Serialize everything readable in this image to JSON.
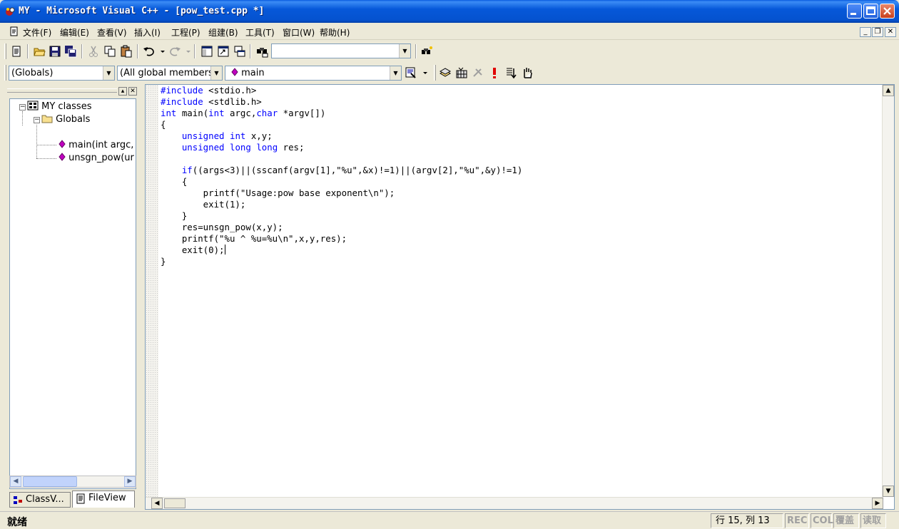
{
  "window": {
    "title": "MY - Microsoft Visual C++ - [pow_test.cpp *]"
  },
  "menu": {
    "items": [
      "文件(F)",
      "编辑(E)",
      "查看(V)",
      "插入(I)",
      "工程(P)",
      "组建(B)",
      "工具(T)",
      "窗口(W)",
      "帮助(H)"
    ]
  },
  "toolbar": {
    "find_value": ""
  },
  "wizardbar": {
    "scope": "(Globals)",
    "filter": "(All global members",
    "member": "main"
  },
  "workspace": {
    "tree": {
      "root": "MY classes",
      "folder": "Globals",
      "items": [
        "main(int argc,",
        "unsgn_pow(ur"
      ]
    },
    "tabs": [
      "ClassV...",
      "FileView"
    ]
  },
  "editor": {
    "lines": [
      "#include <stdio.h>",
      "#include <stdlib.h>",
      "int main(int argc,char *argv[])",
      "{",
      "    unsigned int x,y;",
      "    unsigned long long res;",
      "",
      "    if((args<3)||(sscanf(argv[1],\"%u\",&x)!=1)||(argv[2],\"%u\",&y)!=1)",
      "    {",
      "        printf(\"Usage:pow base exponent\\n\");",
      "        exit(1);",
      "    }",
      "    res=unsgn_pow(x,y);",
      "    printf(\"%u ^ %u=%u\\n\",x,y,res);",
      "    exit(0);",
      "}"
    ],
    "keywords": [
      "#include",
      "int",
      "char",
      "unsigned",
      "long",
      "if"
    ],
    "caret_line": 15
  },
  "status": {
    "message": "就绪",
    "position": "行 15, 列 13",
    "rec": "REC",
    "col": "COL",
    "ovr": "覆盖",
    "read": "读取"
  },
  "colors": {
    "keyword": "#0000ff",
    "title_bar": "#0552cf",
    "chrome": "#ece9d8"
  }
}
